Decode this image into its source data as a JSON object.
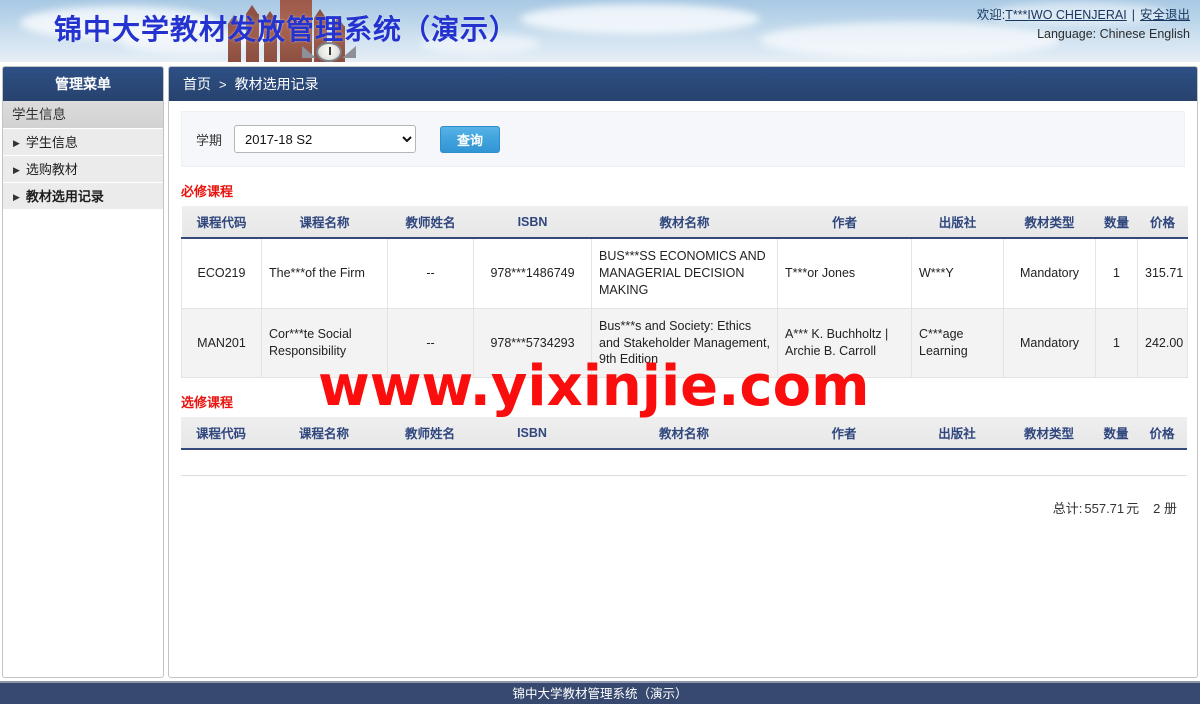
{
  "banner": {
    "title": "锦中大学教材发放管理系统（演示）",
    "welcome_prefix": "欢迎:",
    "user_name": "T***IWO CHENJERAI",
    "separator": "|",
    "logout": "安全退出",
    "language_label": "Language:",
    "language_chinese": "Chinese",
    "language_english": "English"
  },
  "sidebar": {
    "header": "管理菜单",
    "section": "学生信息",
    "items": [
      {
        "label": "学生信息",
        "arrow": "▶",
        "active": false
      },
      {
        "label": "选购教材",
        "arrow": "▶",
        "active": false
      },
      {
        "label": "教材选用记录",
        "arrow": "▶",
        "active": true
      }
    ]
  },
  "breadcrumb": {
    "home": "首页",
    "separator": ">",
    "current": "教材选用记录"
  },
  "filter": {
    "term_label": "学期",
    "term_value": "2017-18 S2",
    "term_options": [
      "2017-18 S2"
    ],
    "query_button": "查询"
  },
  "columns": [
    "课程代码",
    "课程名称",
    "教师姓名",
    "ISBN",
    "教材名称",
    "作者",
    "出版社",
    "教材类型",
    "数量",
    "价格"
  ],
  "required_section": {
    "title": "必修课程",
    "rows": [
      {
        "course_code": "ECO219",
        "course_name": "The***of the Firm",
        "teacher": "--",
        "isbn": "978***1486749",
        "book_name": "BUS***SS ECONOMICS AND MANAGERIAL DECISION MAKING",
        "author": "T***or Jones",
        "publisher": "W***Y",
        "book_type": "Mandatory",
        "quantity": "1",
        "price": "315.71"
      },
      {
        "course_code": "MAN201",
        "course_name": "Cor***te Social Responsibility",
        "teacher": "--",
        "isbn": "978***5734293",
        "book_name": "Bus***s and Society: Ethics and Stakeholder Management, 9th Edition",
        "author": "A*** K. Buchholtz | Archie B. Carroll",
        "publisher": "C***age Learning",
        "book_type": "Mandatory",
        "quantity": "1",
        "price": "242.00"
      }
    ]
  },
  "elective_section": {
    "title": "选修课程",
    "rows": []
  },
  "totals": {
    "label": "总计:",
    "amount": "557.71",
    "currency": "元",
    "books_count": "2 册"
  },
  "watermark": "www.yixinjie.com",
  "footer": "锦中大学教材管理系统（演示）",
  "colors": {
    "header_blue": "#2a4878",
    "title_blue": "#2433cf",
    "section_red": "#e8150f",
    "button_blue": "#3fa2dc",
    "footer_navy": "#37496e",
    "table_header_text": "#30477e",
    "watermark_red": "#fa0d0d"
  }
}
